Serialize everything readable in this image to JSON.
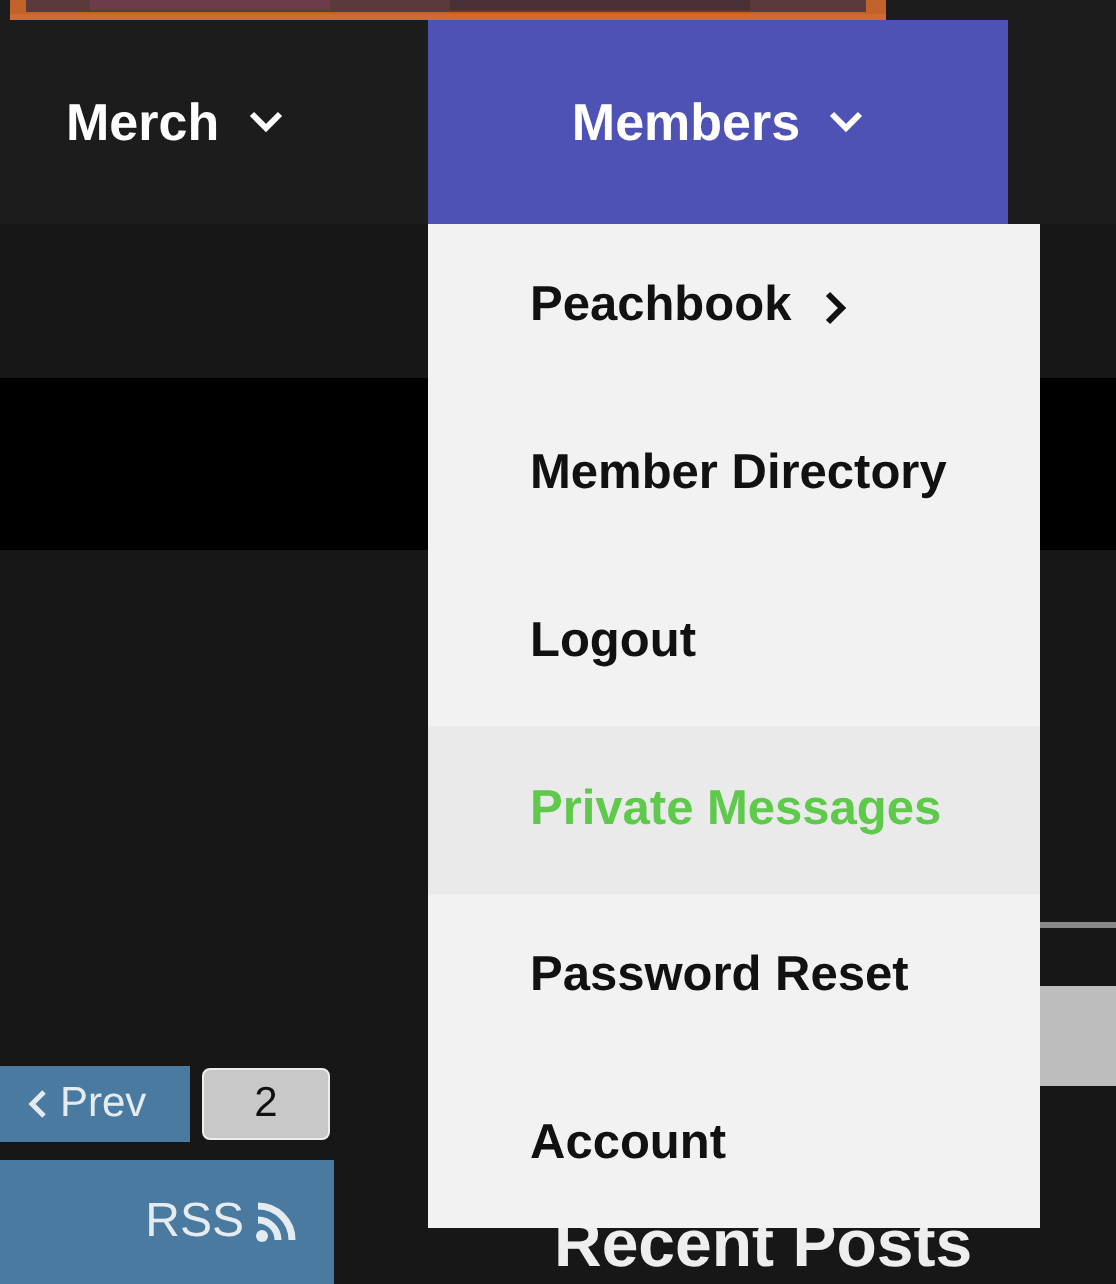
{
  "nav": [
    {
      "label": "Merch",
      "selected": false
    },
    {
      "label": "Members",
      "selected": true
    }
  ],
  "dropdown": [
    {
      "label": "Peachbook",
      "submenu": true,
      "highlighted": false
    },
    {
      "label": "Member Directory",
      "submenu": false,
      "highlighted": false
    },
    {
      "label": "Logout",
      "submenu": false,
      "highlighted": false
    },
    {
      "label": "Private Messages",
      "submenu": false,
      "highlighted": true
    },
    {
      "label": "Password Reset",
      "submenu": false,
      "highlighted": false
    },
    {
      "label": "Account",
      "submenu": false,
      "highlighted": false
    }
  ],
  "pagination": {
    "prev": "Prev",
    "pages": [
      {
        "label": "2"
      }
    ]
  },
  "rss": "RSS",
  "heading": "Recent Posts"
}
